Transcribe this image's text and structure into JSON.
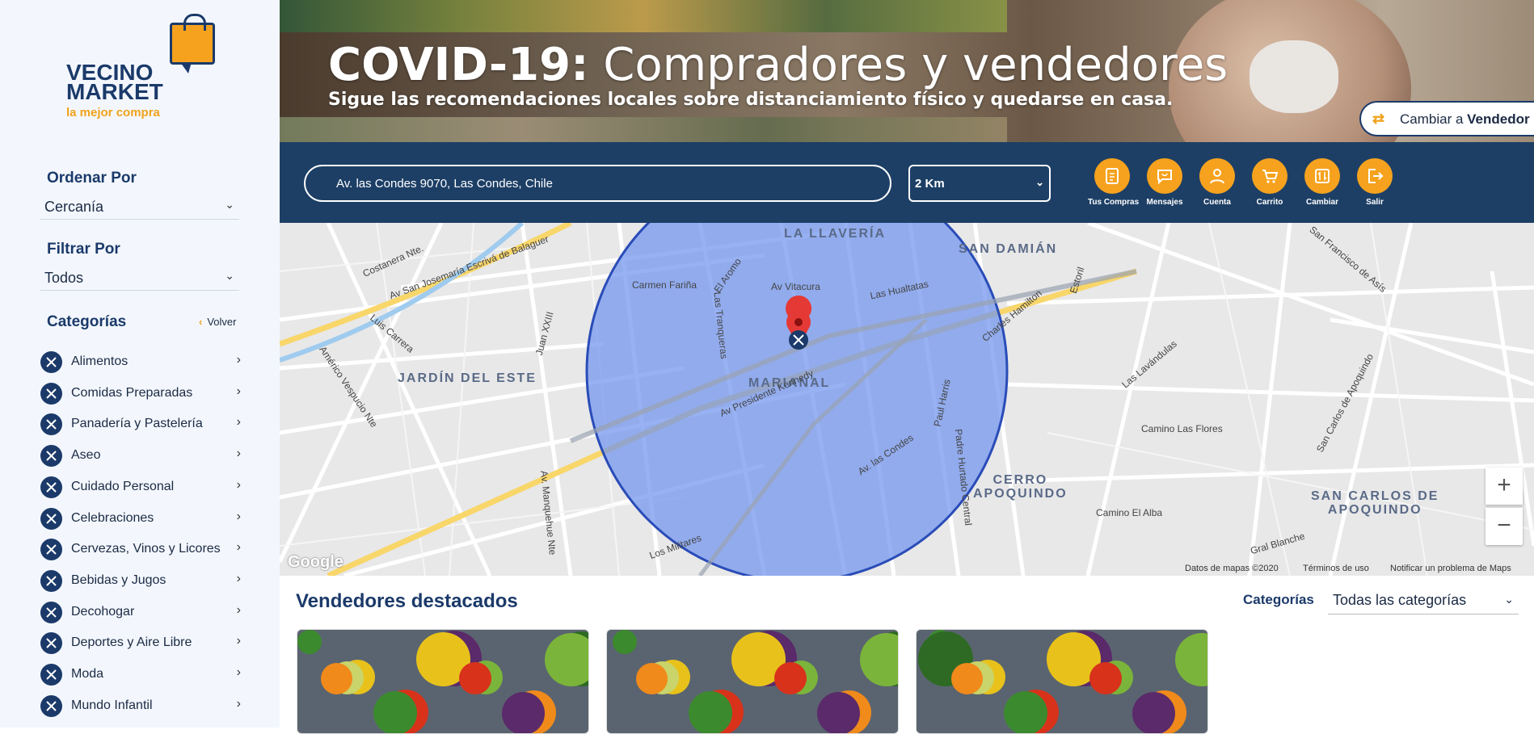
{
  "brand": {
    "line1": "VECINO",
    "line2": "MARKET",
    "tagline": "la mejor compra"
  },
  "sidebar": {
    "sort": {
      "heading": "Ordenar Por",
      "value": "Cercanía"
    },
    "filter": {
      "heading": "Filtrar Por",
      "value": "Todos"
    },
    "categories_heading": "Categorías",
    "back_label": "Volver",
    "categories": [
      {
        "label": "Alimentos"
      },
      {
        "label": "Comidas Preparadas"
      },
      {
        "label": "Panadería y Pastelería"
      },
      {
        "label": "Aseo"
      },
      {
        "label": "Cuidado Personal"
      },
      {
        "label": "Celebraciones"
      },
      {
        "label": "Cervezas, Vinos y Licores"
      },
      {
        "label": "Bebidas y Jugos"
      },
      {
        "label": "Decohogar"
      },
      {
        "label": "Deportes y Aire Libre"
      },
      {
        "label": "Moda"
      },
      {
        "label": "Mundo Infantil"
      }
    ]
  },
  "banner": {
    "title_bold": "COVID-19:",
    "title_rest": " Compradores y vendedores",
    "subtitle": "Sigue las recomendaciones locales sobre distanciamiento físico y quedarse en casa.",
    "switch_prefix": "Cambiar a ",
    "switch_bold": "Vendedor"
  },
  "search": {
    "address": "Av. las Condes 9070, Las Condes, Chile",
    "distance": "2 Km"
  },
  "toolbar": [
    {
      "label": "Tus Compras",
      "icon": "receipt-icon"
    },
    {
      "label": "Mensajes",
      "icon": "message-bag-icon"
    },
    {
      "label": "Cuenta",
      "icon": "user-icon"
    },
    {
      "label": "Carrito",
      "icon": "cart-icon"
    },
    {
      "label": "Cambiar",
      "icon": "swap-icon"
    },
    {
      "label": "Salir",
      "icon": "logout-icon"
    }
  ],
  "map": {
    "areas": [
      "LA LLAVERÍA",
      "SAN DAMIÁN",
      "JARDÍN DEL ESTE",
      "MARIANAL",
      "CERRO\nAPOQUINDO",
      "SAN CARLOS DE\nAPOQUINDO"
    ],
    "streets": [
      "Costanera Nte.",
      "Av San Josemaría Escrivá de Balaguer",
      "Carmen Fariña",
      "El Aromo",
      "Av Vitacura",
      "Las Hualtatas",
      "Las Tranqueras",
      "Luis Carrera",
      "Juan XXIII",
      "Américo Vespucio Nte",
      "Av Presidente Kennedy",
      "Charles Hamilton",
      "Paul Harris",
      "Camino Las Flores",
      "Av. las Condes",
      "Padre Hurtado Central",
      "Camino El Alba",
      "Los Militares",
      "Av. Manquehue Nte",
      "Estoril",
      "San Francisco de Asís",
      "Las Lavándulas",
      "San Carlos de Apoquindo",
      "Gral Blanche"
    ],
    "attribution": [
      "Datos de mapas ©2020",
      "Términos de uso",
      "Notificar un problema de Maps"
    ],
    "google": "Google",
    "zoom_in": "+",
    "zoom_out": "−"
  },
  "featured": {
    "title": "Vendedores destacados",
    "category_label": "Categorías",
    "category_value": "Todas las categorías"
  },
  "colors": {
    "navy": "#1d3f66",
    "orange": "#f6a21e",
    "radius_fill": "#6f93ee"
  }
}
